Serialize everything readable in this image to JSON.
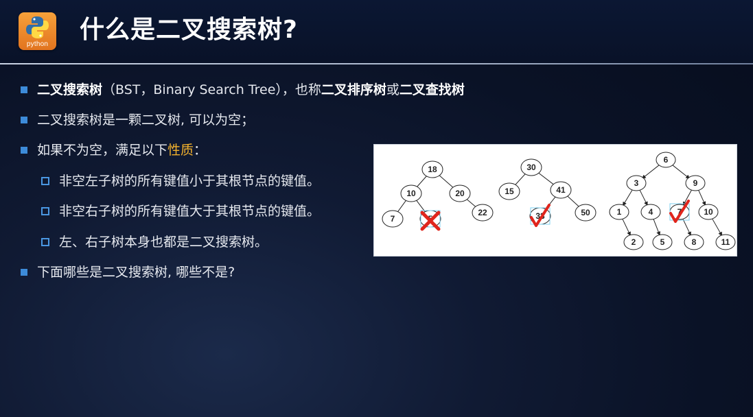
{
  "logo": {
    "text": "python"
  },
  "title": "什么是二叉搜索树?",
  "bullets": [
    {
      "level": 1,
      "parts": [
        {
          "text": "二叉搜索树",
          "style": "bold"
        },
        {
          "text": "（BST，Binary Search Tree），也称",
          "style": "normal"
        },
        {
          "text": "二叉排序树",
          "style": "bold"
        },
        {
          "text": "或",
          "style": "normal"
        },
        {
          "text": "二叉查找树",
          "style": "bold"
        }
      ]
    },
    {
      "level": 1,
      "parts": [
        {
          "text": "二叉搜索树是一颗二叉树, 可以为空；",
          "style": "normal"
        }
      ]
    },
    {
      "level": 1,
      "parts": [
        {
          "text": "如果不为空，满足以下",
          "style": "normal"
        },
        {
          "text": "性质",
          "style": "highlight"
        },
        {
          "text": "：",
          "style": "normal"
        }
      ]
    },
    {
      "level": 2,
      "parts": [
        {
          "text": "非空左子树的所有键值小于其根节点的键值。",
          "style": "normal"
        }
      ]
    },
    {
      "level": 2,
      "parts": [
        {
          "text": "非空右子树的所有键值大于其根节点的键值。",
          "style": "normal"
        }
      ]
    },
    {
      "level": 2,
      "parts": [
        {
          "text": "左、右子树本身也都是二叉搜索树。",
          "style": "normal"
        }
      ]
    },
    {
      "level": 1,
      "parts": [
        {
          "text": "下面哪些是二叉搜索树, 哪些不是?",
          "style": "normal"
        }
      ]
    }
  ],
  "diagram": {
    "trees": [
      {
        "nodes": [
          "18",
          "10",
          "20",
          "7",
          "5",
          "22"
        ],
        "edges": [
          [
            "18",
            "10"
          ],
          [
            "18",
            "20"
          ],
          [
            "10",
            "7"
          ],
          [
            "10",
            "5"
          ],
          [
            "20",
            "22"
          ]
        ],
        "mark": {
          "type": "cross",
          "at": "5"
        }
      },
      {
        "nodes": [
          "30",
          "15",
          "41",
          "33",
          "50"
        ],
        "edges": [
          [
            "30",
            "15"
          ],
          [
            "30",
            "41"
          ],
          [
            "41",
            "33"
          ],
          [
            "41",
            "50"
          ]
        ],
        "mark": {
          "type": "check",
          "at": "33"
        }
      },
      {
        "nodes": [
          "6",
          "3",
          "9",
          "1",
          "4",
          "7",
          "10",
          "2",
          "5",
          "8",
          "11"
        ],
        "edges": [
          [
            "6",
            "3"
          ],
          [
            "6",
            "9"
          ],
          [
            "3",
            "1"
          ],
          [
            "3",
            "4"
          ],
          [
            "9",
            "7"
          ],
          [
            "9",
            "10"
          ],
          [
            "1",
            "2"
          ],
          [
            "4",
            "5"
          ],
          [
            "7",
            "8"
          ],
          [
            "10",
            "11"
          ]
        ],
        "mark": {
          "type": "check",
          "at": "7"
        }
      }
    ]
  },
  "colors": {
    "bullet_marker": "#3d8bd9",
    "highlight": "#f2b12d",
    "check_mark": "#e0251c",
    "cross_mark": "#e0251c",
    "background": "#0a1226"
  }
}
